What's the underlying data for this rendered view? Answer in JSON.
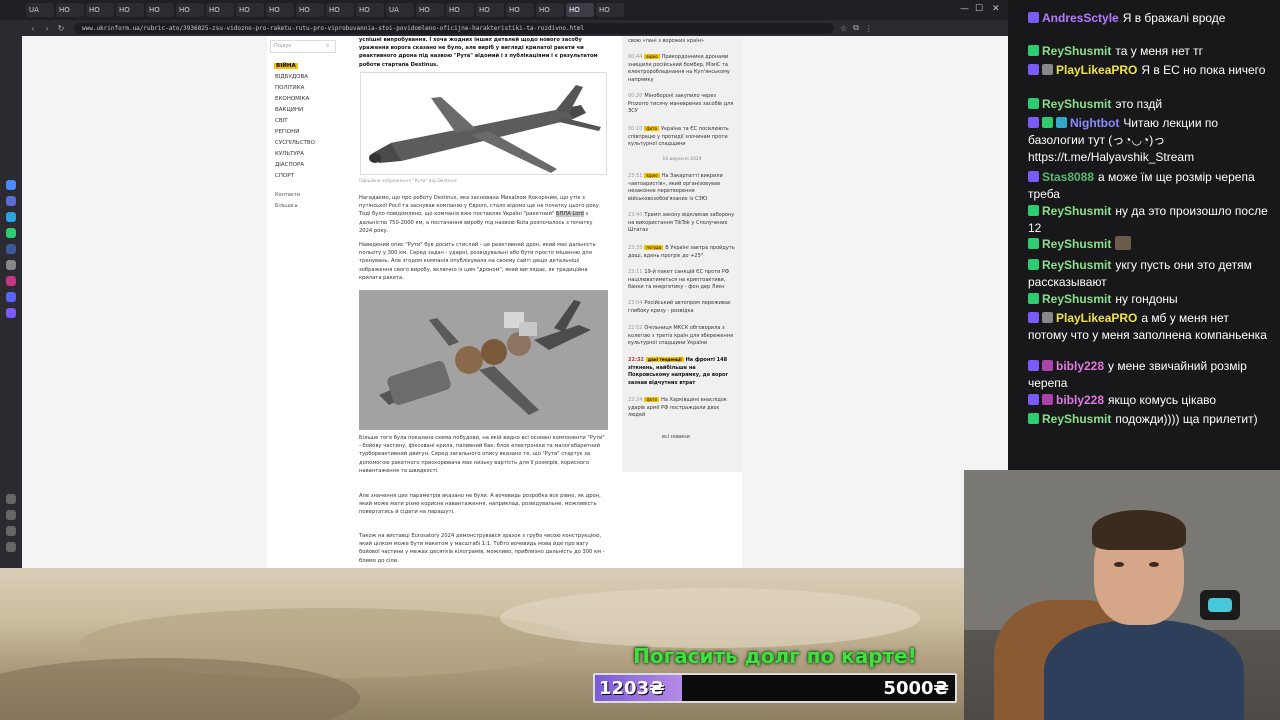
{
  "browser": {
    "tabs": [
      "UA",
      "НО",
      "НО",
      "НО",
      "НО",
      "НО",
      "НО",
      "НО",
      "НО",
      "НО",
      "НО",
      "НО",
      "UA",
      "НО",
      "НО",
      "НО",
      "НО",
      "НО",
      "НО",
      "НО"
    ],
    "url": "www.ukrinform.ua/rubric-ato/3936825-zsu-vidozno-pro-raketu-rutu-pro-viprobuvannia-stoi-povidomleno-oficijne-harakteristiki-ta-rozdivno.html"
  },
  "site": {
    "search_placeholder": "Пошук",
    "nav": [
      "ВІЙНА",
      "ВІДБУДОВА",
      "ПОЛІТИКА",
      "ЕКОНОМІКА",
      "ВАКЦИНИ",
      "СВІТ",
      "РЕГІОНИ",
      "СУСПІЛЬСТВО",
      "КУЛЬТУРА",
      "ДІАСПОРА",
      "СПОРТ"
    ],
    "nav_small": [
      "Контакти",
      "Більше ▸"
    ]
  },
  "article": {
    "lead": "успішні випробування. І хоча жодних інших деталей щодо нового засобу ураження ворога сказано не було, але виріб у вигляді крилатої ракети чи реактивного дрона під назвою \"Рута\" відомий і з публікаціями і є результатом роботи стартапа Destinus.",
    "caption1": "Офіційне зображення \"Рути\" від Destinus",
    "p1_before": "Нагадаємо, що про роботу Destinus, яка заснована Михаїлом Кокоріним, що утік з путінської Росії та заснував компанію у Європі, стало відомо ще на початку цього року. Тоді було повідомлено, що компанія вже поставляє Україні \"ракетний\"",
    "p1_highlight": "БПЛА Lord",
    "p1_after": "з дальністю 750-2000 км, а постачання виробу під назвою Ruta розпочалось з початку 2024 року.",
    "p2": "Наведений опис \"Рути\" був досить стислий - це реактивний дрон, який має дальність польоту у 300 км. Серед задач - ударні, розвідувальні або бути просто мішенню для тренувань. Але згодом компанія опублікувала на своєму сайті дещо детальніші зображення свого виробу, включно із цим \"дроном\", який виглядає, як традиційна крилата ракета.",
    "p3": "Більше того була показана схема побудови, на якій видно всі основні компоненти \"Рути\" - бойову частину, фіксовані крила, паливний бак, блок електроніки та малогабаритний турбореактивний двигун. Серед загального опису вказано те, що \"Рута\" стартує за допомогою ракетного прискорювача має низьку вартість для її розмірів, корисного навантаження та швидкості.",
    "p4": "Але значення цих параметрів вказано не були. А вочевидь розробка все рівно, як дрон, який може мати різне корисне навантаження, наприклад, розвідувальне, можливість повертатись й сідати на парашуті.",
    "p5": "Також на виставці Eurosatory 2024 демонструвався зразок з грубо чисою конструкцією, який цілком може бути макетом у масштабі 1:1. Тобто вочевидь мова йде про вагу бойової частини у межах десятків кілограмів, можливо, приблизно дальність до 300 км - блимо до сіли."
  },
  "feed": {
    "top": "свою «пані з ворожих країн»",
    "items": [
      {
        "time": "00:44",
        "badge": "відео",
        "text": "Прикордонники дронами знищили російський бомбер, МіміС та електроробладнання на Куп'янському напрямку"
      },
      {
        "time": "00:20",
        "badge": "",
        "text": "Мінобороні закупило через Prozorro тисячу маневрених засобів для ЗСУ"
      },
      {
        "time": "00:10",
        "badge": "фото",
        "text": "Україна та ЄС посилюють співпрацю у протидії злочинам проти культурної спадщини"
      }
    ],
    "date": "16 вересня 2024",
    "items2": [
      {
        "time": "23:51",
        "badge": "відео",
        "text": "На Закарпатті викрили «автоаристів», який організовував незаконне перетворення військовозобов'язаних із СЗЮ"
      },
      {
        "time": "23:40",
        "badge": "",
        "text": "Трамп закону відкликав заборону на використання TikTok у Сполучених Штатах"
      },
      {
        "time": "23:35",
        "badge": "погода",
        "text": "В Україні завтра пройдуть дощі, вдень прогріє до +25°"
      },
      {
        "time": "23:11",
        "badge": "",
        "text": "19-й пакет санкцій ЄС проти РФ націлюватиметься на криптоактиви, банки та енергетику - фон дер Ляєн"
      },
      {
        "time": "23:04",
        "badge": "",
        "text": "Російський автопром переживає глибоку кризу - розвідка"
      },
      {
        "time": "22:52",
        "badge": "",
        "text": "Очільниця МКСК обговорила з колегою з третіх країн для збереження культурної спадщини України"
      },
      {
        "time": "22:32",
        "badge": "дані тенденції",
        "text": "На фронті 148 зіткнень, найбільше на Покровському напрямку, де ворог зазнав відчутних втрат",
        "bold": true
      },
      {
        "time": "22:24",
        "badge": "фото",
        "text": "На Харківщині внаслідок ударів армії РФ постраждали двоє людей"
      }
    ],
    "more": "всі новини"
  },
  "chat": [
    {
      "user": "AndresSctyle",
      "text": "Я в бражалі вроде",
      "color": "#b37cff",
      "badges": [
        "#7a5af8"
      ]
    },
    {
      "user": "ReyShusmit",
      "text": "та у меня нет тг",
      "color": "#8be08b",
      "badges": [
        "#2ecc71"
      ]
    },
    {
      "user": "PlayLikeaPRO",
      "text": "Я в ЕС но пока ничего",
      "color": "#f0e34a",
      "badges": [
        "#7a5af8",
        "#888888"
      ]
    },
    {
      "user": "ReyShusmit",
      "text": "это пздй",
      "color": "#8be08b",
      "badges": [
        "#2ecc71"
      ]
    },
    {
      "user": "Nightbot",
      "text": "Читаю лекции по базологии тут (っ◔◡◔)っ https://t.me/Halyavshik_Stream",
      "color": "#8a8cff",
      "badges": [
        "#7a5af8",
        "#2ecc71",
        "#31a9c7"
      ]
    },
    {
      "user": "Stas8088",
      "text": "а може їм ще розмір черепа треба",
      "color": "#56b870",
      "badges": [
        "#7a5af8"
      ]
    },
    {
      "user": "ReyShusmit",
      "text": "ну да это произошло после 12",
      "color": "#8be08b",
      "badges": [
        "#2ecc71"
      ]
    },
    {
      "user": "ReyShusmit",
      "text": "",
      "color": "#8be08b",
      "badges": [
        "#2ecc71"
      ],
      "emote": true
    },
    {
      "user": "ReyShusmit",
      "text": "укгу пусть они это детям рассказывают",
      "color": "#8be08b",
      "badges": [
        "#2ecc71"
      ]
    },
    {
      "user": "ReyShusmit",
      "text": "ну гондоны",
      "color": "#8be08b",
      "badges": [
        "#2ecc71"
      ]
    },
    {
      "user": "PlayLikeaPRO",
      "text": "а мб у меня нет потому что у меня заполнена компаньенка",
      "color": "#f0e34a",
      "badges": [
        "#7a5af8",
        "#888888"
      ]
    },
    {
      "user": "bibly228",
      "text": "у мене звичайний розмір черепа",
      "color": "#e07ae0",
      "badges": [
        "#7a5af8",
        "#aa44aa"
      ]
    },
    {
      "user": "bibly228",
      "text": "якщо комусь цікаво",
      "color": "#e07ae0",
      "badges": [
        "#7a5af8",
        "#aa44aa"
      ]
    },
    {
      "user": "ReyShusmit",
      "text": "подожди)))) ща прилетит)",
      "color": "#8be08b",
      "badges": [
        "#2ecc71"
      ]
    }
  ],
  "goal": {
    "title": "Погасить долг по карте!",
    "current": "1203₴",
    "target": "5000₴",
    "progress": 0.2406,
    "fill_color": "#7a5ad8"
  },
  "icons": {
    "search": "search-icon",
    "back": "back-icon",
    "forward": "forward-icon",
    "reload": "reload-icon"
  }
}
